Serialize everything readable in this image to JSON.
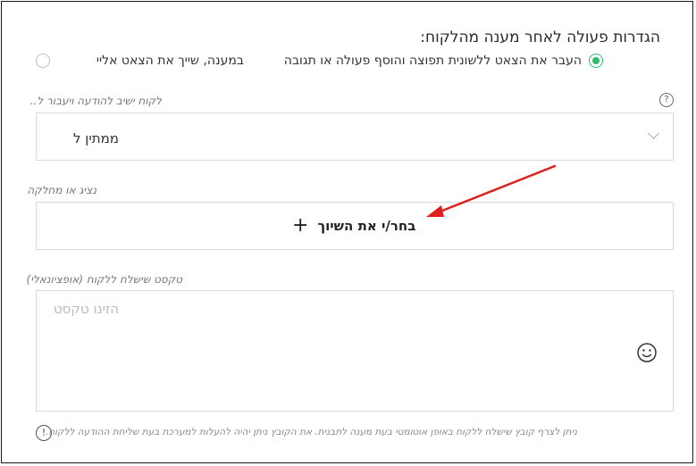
{
  "section": {
    "title": "הגדרות פעולה לאחר מענה מהלקוח:"
  },
  "radio_options": [
    {
      "label": "העבר את הצאט ללשונית תפוצה והוסף פעולה או תגובה",
      "checked": true
    },
    {
      "label": "במענה, שייך את הצאט אליי",
      "checked": false
    }
  ],
  "wait_field": {
    "label": "לקוח ישיב להודעה ויעבור ל..",
    "value": "ממתין ל",
    "help_icon": "question-circle-icon",
    "dropdown_icon": "chevron-down-icon"
  },
  "assign_field": {
    "label": "נציג או מחלקה",
    "button_label": "בחר/י את השיוך",
    "button_icon": "plus-icon"
  },
  "message_field": {
    "label": "טקסט שישלח ללקוח (אופציונאלי)",
    "placeholder": "הזינו טקסט",
    "emoji_icon": "smiley-icon"
  },
  "footnote": {
    "text": "ניתן לצרף קובץ שישלח ללקוח באופן אוטומטי בעת מענה לתבנית. את הקובץ ניתן יהיה להעלות למערכת בעת שליחת ההודעה ללקוח.",
    "icon": "info-icon"
  },
  "annotation": {
    "arrow_color": "#e02020"
  },
  "colors": {
    "accent_green": "#2dbd6e",
    "border": "#d9d9d9"
  }
}
